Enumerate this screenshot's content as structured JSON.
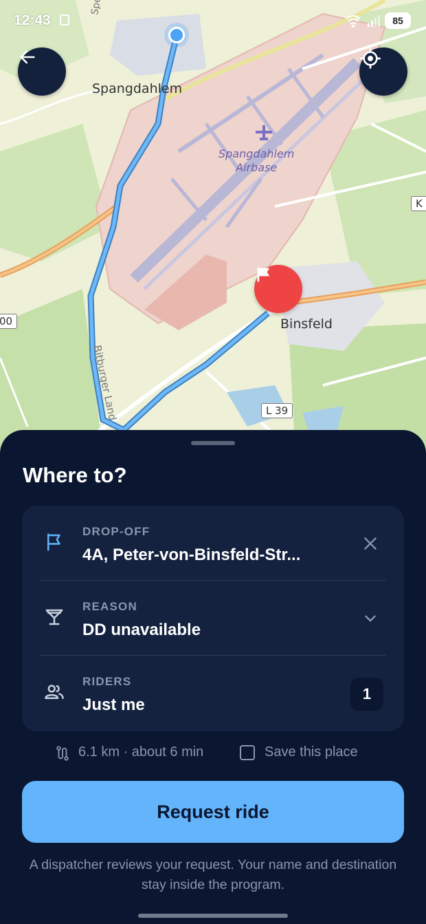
{
  "status_bar": {
    "time": "12:43",
    "battery": "85"
  },
  "map": {
    "place_labels": {
      "spangdahlem": "Spangdahlem",
      "airbase": "Spangdahlem\nAirbase",
      "binsfeld": "Binsfeld",
      "bitburger_land": "Bitburger Land",
      "speicher": "Speicher"
    },
    "road_labels": {
      "l39": "L 39",
      "left_edge": "00",
      "right_edge": "K"
    },
    "route_color": "#5aa9f0",
    "origin_color": "#4da3f5",
    "destination_color": "#ef4444"
  },
  "sheet": {
    "title": "Where to?",
    "dropoff": {
      "label": "DROP-OFF",
      "value": "4A, Peter-von-Binsfeld-Str..."
    },
    "reason": {
      "label": "REASON",
      "value": "DD unavailable"
    },
    "riders": {
      "label": "RIDERS",
      "value": "Just me",
      "count": "1"
    },
    "trip_summary": "6.1 km · about 6 min",
    "save_place_label": "Save this place",
    "request_button": "Request ride",
    "note": "A dispatcher reviews your request. Your name and destination stay inside the program."
  },
  "colors": {
    "accent": "#63b4fb",
    "sheet_bg": "#0b1630",
    "card_bg": "#14223f"
  }
}
